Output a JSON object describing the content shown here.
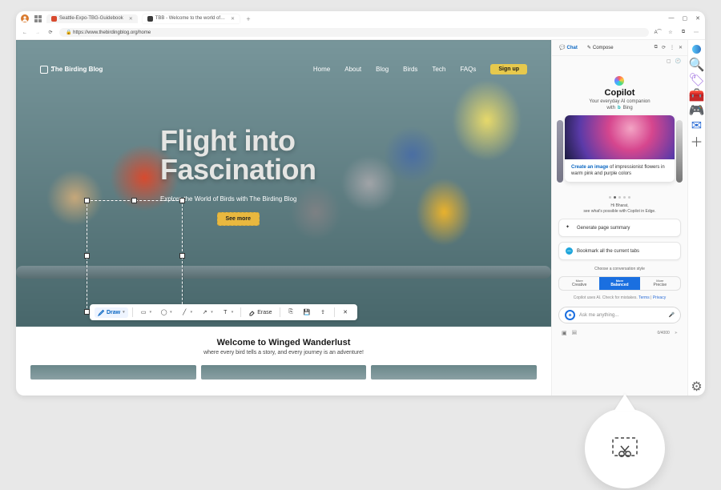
{
  "tabs": [
    {
      "favicon": "#d84a2e",
      "title": "Seattle-Expo-TBG-Guidebook"
    },
    {
      "favicon": "#3a3a3a",
      "title": "TBB - Welcome to the world of…"
    }
  ],
  "addressBar": {
    "url": "https://www.thebirdingblog.org/home"
  },
  "site": {
    "brand": "The Birding Blog",
    "nav": [
      "Home",
      "About",
      "Blog",
      "Birds",
      "Tech",
      "FAQs"
    ],
    "signup": "Sign up",
    "heroTitle1": "Flight into",
    "heroTitle2": "Fascination",
    "heroSub": "Explore the World of Birds with The Birding Blog",
    "cta": "See more"
  },
  "toolbar": {
    "draw": "Draw",
    "erase": "Erase"
  },
  "content": {
    "h2": "Welcome to Winged Wanderlust",
    "p": "where every bird tells a story, and every journey is an adventure!"
  },
  "copilot": {
    "tabs": {
      "chat": "Chat",
      "compose": "Compose"
    },
    "title": "Copilot",
    "subtitle": "Your everyday AI companion",
    "withLabel": "with",
    "bing": "Bing",
    "promptCard": {
      "lead": "Create an image",
      "rest": " of impressionist flowers in warm pink and purple colors"
    },
    "greeting1": "Hi Bharat,",
    "greeting2": "see what's possible with Copilot in Edge.",
    "sugg1": "Generate page summary",
    "sugg2": "Bookmark all the current tabs",
    "styleLabel": "Choose a conversation style",
    "styles": [
      {
        "s1": "More",
        "s2": "Creative"
      },
      {
        "s1": "More",
        "s2": "Balanced"
      },
      {
        "s1": "More",
        "s2": "Precise"
      }
    ],
    "disclaimer": "Copilot uses AI. Check for mistakes. ",
    "terms": "Terms",
    "privacy": "Privacy",
    "placeholder": "Ask me anything...",
    "counter": "0/4000"
  }
}
